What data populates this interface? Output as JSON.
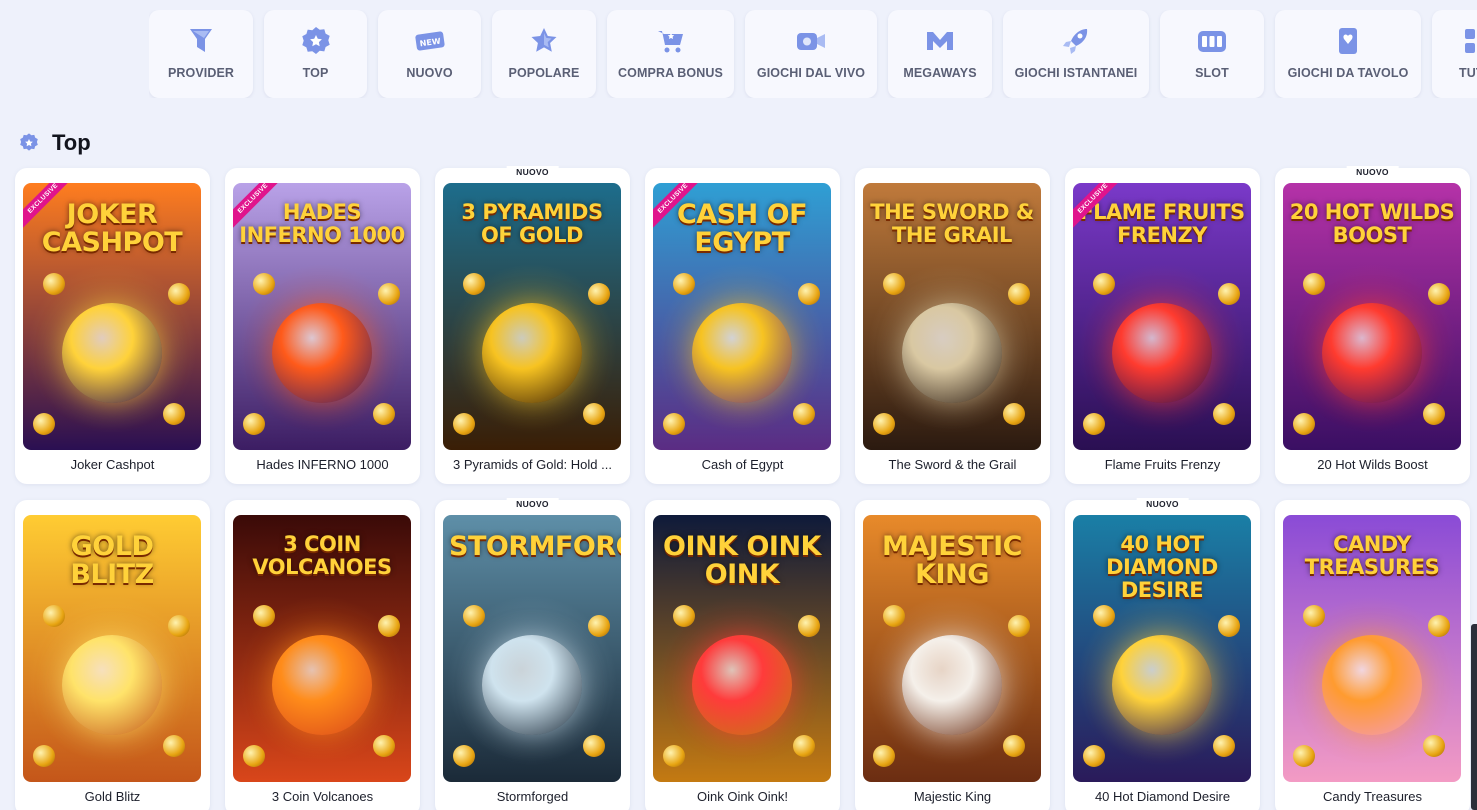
{
  "categories": [
    {
      "label": "PROVIDER",
      "icon": "provider-icon",
      "width": 104
    },
    {
      "label": "TOP",
      "icon": "top-badge-icon",
      "width": 103
    },
    {
      "label": "NUOVO",
      "icon": "new-icon",
      "width": 103
    },
    {
      "label": "POPOLARE",
      "icon": "star-icon",
      "width": 104
    },
    {
      "label": "COMPRA BONUS",
      "icon": "cart-icon",
      "width": 127
    },
    {
      "label": "GIOCHI DAL VIVO",
      "icon": "camera-icon",
      "width": 132
    },
    {
      "label": "MEGAWAYS",
      "icon": "megaways-icon",
      "width": 104
    },
    {
      "label": "GIOCHI ISTANTANEI",
      "icon": "rocket-icon",
      "width": 146
    },
    {
      "label": "SLOT",
      "icon": "slot-icon",
      "width": 104
    },
    {
      "label": "GIOCHI DA TAVOLO",
      "icon": "cards-icon",
      "width": 146
    },
    {
      "label": "TUTTI",
      "icon": "grid-icon",
      "width": 90
    }
  ],
  "section": {
    "title": "Top",
    "icon": "top-badge-icon"
  },
  "badges": {
    "exclusive": "EXCLUSIVE",
    "new": "NUOVO"
  },
  "games": [
    {
      "name": "Joker Cashpot",
      "art_title": "JOKER CASHPOT",
      "exclusive": true,
      "is_new": false,
      "bg1": "#ff7d1f",
      "bg2": "#2a0f52",
      "accent": "#ffd23a"
    },
    {
      "name": "Hades INFERNO 1000",
      "art_title": "HADES INFERNO 1000",
      "exclusive": true,
      "is_new": false,
      "bg1": "#b9a2e8",
      "bg2": "#3c1d63",
      "accent": "#ff5a1a"
    },
    {
      "name": "3 Pyramids of Gold: Hold ...",
      "art_title": "3 PYRAMIDS OF GOLD",
      "exclusive": false,
      "is_new": true,
      "bg1": "#1d6d8c",
      "bg2": "#3a1e05",
      "accent": "#f7c321"
    },
    {
      "name": "Cash of Egypt",
      "art_title": "CASH OF EGYPT",
      "exclusive": true,
      "is_new": false,
      "bg1": "#2f9fd4",
      "bg2": "#5b2c83",
      "accent": "#f7c321"
    },
    {
      "name": "The Sword & the Grail",
      "art_title": "THE SWORD & THE GRAIL",
      "exclusive": false,
      "is_new": false,
      "bg1": "#c07a3b",
      "bg2": "#2b1a10",
      "accent": "#d9c8a2"
    },
    {
      "name": "Flame Fruits Frenzy",
      "art_title": "FLAME FRUITS FRENZY",
      "exclusive": true,
      "is_new": false,
      "bg1": "#7a39c9",
      "bg2": "#2a0f52",
      "accent": "#ff3b2f"
    },
    {
      "name": "20 Hot Wilds Boost",
      "art_title": "20 HOT WILDS BOOST",
      "exclusive": false,
      "is_new": true,
      "bg1": "#b532a8",
      "bg2": "#3a0f63",
      "accent": "#ff3b2f"
    },
    {
      "name": "Gold Blitz",
      "art_title": "GOLD BLITZ",
      "exclusive": false,
      "is_new": false,
      "bg1": "#ffcc33",
      "bg2": "#c4561a",
      "accent": "#ffe36a"
    },
    {
      "name": "3 Coin Volcanoes",
      "art_title": "3 COIN VOLCANOES",
      "exclusive": false,
      "is_new": false,
      "bg1": "#3a0a08",
      "bg2": "#d9461a",
      "accent": "#ff8c1a"
    },
    {
      "name": "Stormforged",
      "art_title": "STORMFORGED",
      "exclusive": false,
      "is_new": true,
      "bg1": "#5e8fa8",
      "bg2": "#1b2a38",
      "accent": "#cfe3ee"
    },
    {
      "name": "Oink Oink Oink!",
      "art_title": "OINK OINK OINK",
      "exclusive": false,
      "is_new": false,
      "bg1": "#0e1a3a",
      "bg2": "#c47a12",
      "accent": "#ff3b3b"
    },
    {
      "name": "Majestic King",
      "art_title": "MAJESTIC KING",
      "exclusive": false,
      "is_new": false,
      "bg1": "#e88a2a",
      "bg2": "#6b2d12",
      "accent": "#f5f0ea"
    },
    {
      "name": "40 Hot Diamond Desire",
      "art_title": "40 HOT DIAMOND DESIRE",
      "exclusive": false,
      "is_new": true,
      "bg1": "#1a7fa6",
      "bg2": "#2a1a5a",
      "accent": "#ffd23a"
    },
    {
      "name": "Candy Treasures",
      "art_title": "CANDY TREASURES",
      "exclusive": false,
      "is_new": false,
      "bg1": "#8a4bd6",
      "bg2": "#f39bc4",
      "accent": "#ff9b2f"
    }
  ],
  "colors": {
    "page_bg": "#eef1fb",
    "chip_bg": "#f7f8fe",
    "icon_blue": "#7b93e6",
    "exclusive": "#e0148c"
  }
}
